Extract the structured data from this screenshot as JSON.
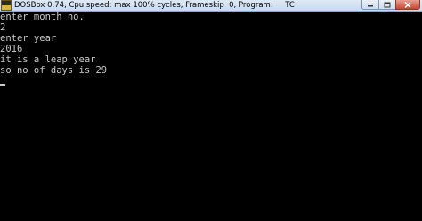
{
  "window": {
    "title": "DOSBox 0.74, Cpu speed: max 100% cycles, Frameskip  0, Program:     TC"
  },
  "icons": {
    "app": "dosbox-app-icon",
    "minimize": "minimize-icon",
    "maximize": "maximize-icon",
    "close": "close-icon"
  },
  "console": {
    "lines": [
      "enter month no.",
      "2",
      "enter year",
      "2016",
      "it is a leap year",
      "so no of days is 29"
    ]
  },
  "colors": {
    "console_bg": "#000000",
    "console_fg": "#c8c8c8",
    "close_button": "#c7452f"
  }
}
